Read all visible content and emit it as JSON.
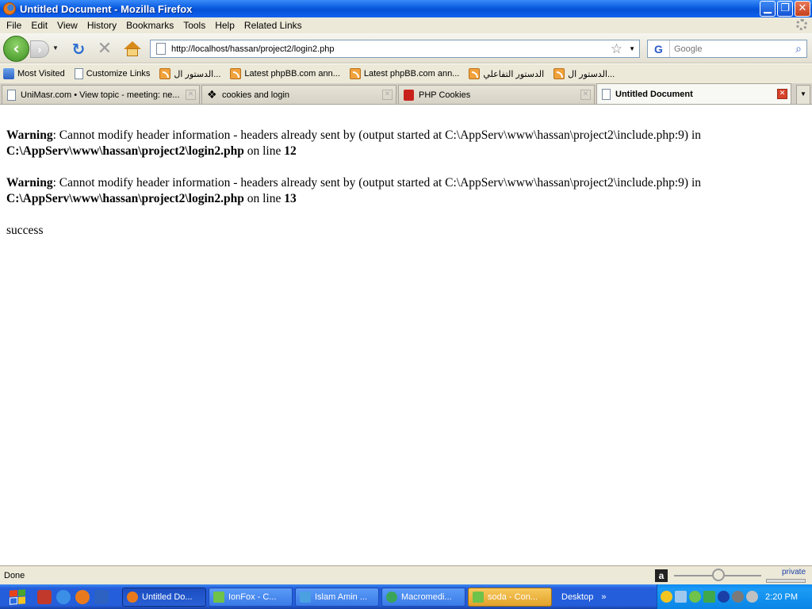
{
  "window": {
    "title": "Untitled Document - Mozilla Firefox",
    "minimize_glyph": "▁",
    "restore_glyph": "❐",
    "close_glyph": "✕"
  },
  "menu": [
    "File",
    "Edit",
    "View",
    "History",
    "Bookmarks",
    "Tools",
    "Help",
    "Related Links"
  ],
  "nav": {
    "back_glyph": "‹",
    "forward_glyph": "›",
    "reload_glyph": "↻",
    "stop_glyph": "✕",
    "url": "http://localhost/hassan/project2/login2.php",
    "star_glyph": "☆",
    "search_placeholder": "Google",
    "search_engine_glyph": "G",
    "search_go_glyph": "⌕"
  },
  "bookmarks": [
    {
      "label": "Most Visited",
      "icon": "most-visited-icon"
    },
    {
      "label": "Customize Links",
      "icon": "page-icon"
    },
    {
      "label": "الدستور ال...",
      "icon": "rss-icon"
    },
    {
      "label": "Latest phpBB.com ann...",
      "icon": "rss-icon"
    },
    {
      "label": "Latest phpBB.com ann...",
      "icon": "rss-icon"
    },
    {
      "label": "الدستور التفاعلي",
      "icon": "rss-icon"
    },
    {
      "label": "الدستور ال...",
      "icon": "rss-icon"
    }
  ],
  "tabs": [
    {
      "label": "UniMasr.com • View topic - meeting: ne...",
      "icon": "page-icon",
      "active": false
    },
    {
      "label": "cookies and login",
      "icon": "code-icon",
      "active": false
    },
    {
      "label": "PHP Cookies",
      "icon": "red-dice-icon",
      "active": false
    },
    {
      "label": "Untitled Document",
      "icon": "page-icon",
      "active": true
    }
  ],
  "content": {
    "warnings": [
      {
        "label": "Warning",
        "message": ": Cannot modify header information - headers already sent by (output started at C:\\AppServ\\www\\hassan\\project2\\include.php:9) in ",
        "file": "C:\\AppServ\\www\\hassan\\project2\\login2.php",
        "on_line": " on line ",
        "line": "12"
      },
      {
        "label": "Warning",
        "message": ": Cannot modify header information - headers already sent by (output started at C:\\AppServ\\www\\hassan\\project2\\include.php:9) in ",
        "file": "C:\\AppServ\\www\\hassan\\project2\\login2.php",
        "on_line": " on line ",
        "line": "13"
      }
    ],
    "output": "success"
  },
  "status": {
    "text": "Done",
    "private_label": "private",
    "zoom_glyph": "a"
  },
  "taskbar": {
    "buttons": [
      {
        "label": "Untitled Do...",
        "icon_color": "#e87a1d",
        "state": "active"
      },
      {
        "label": "IonFox - C...",
        "icon_color": "#6fc24a",
        "state": "normal"
      },
      {
        "label": "Islam Amin ...",
        "icon_color": "#4aa0e0",
        "state": "normal"
      },
      {
        "label": "Macromedi...",
        "icon_color": "#3aa55a",
        "state": "normal"
      },
      {
        "label": "soda - Con...",
        "icon_color": "#6fc24a",
        "state": "flash"
      }
    ],
    "desktop_label": "Desktop",
    "chevron": "»",
    "clock": "2:20 PM"
  }
}
